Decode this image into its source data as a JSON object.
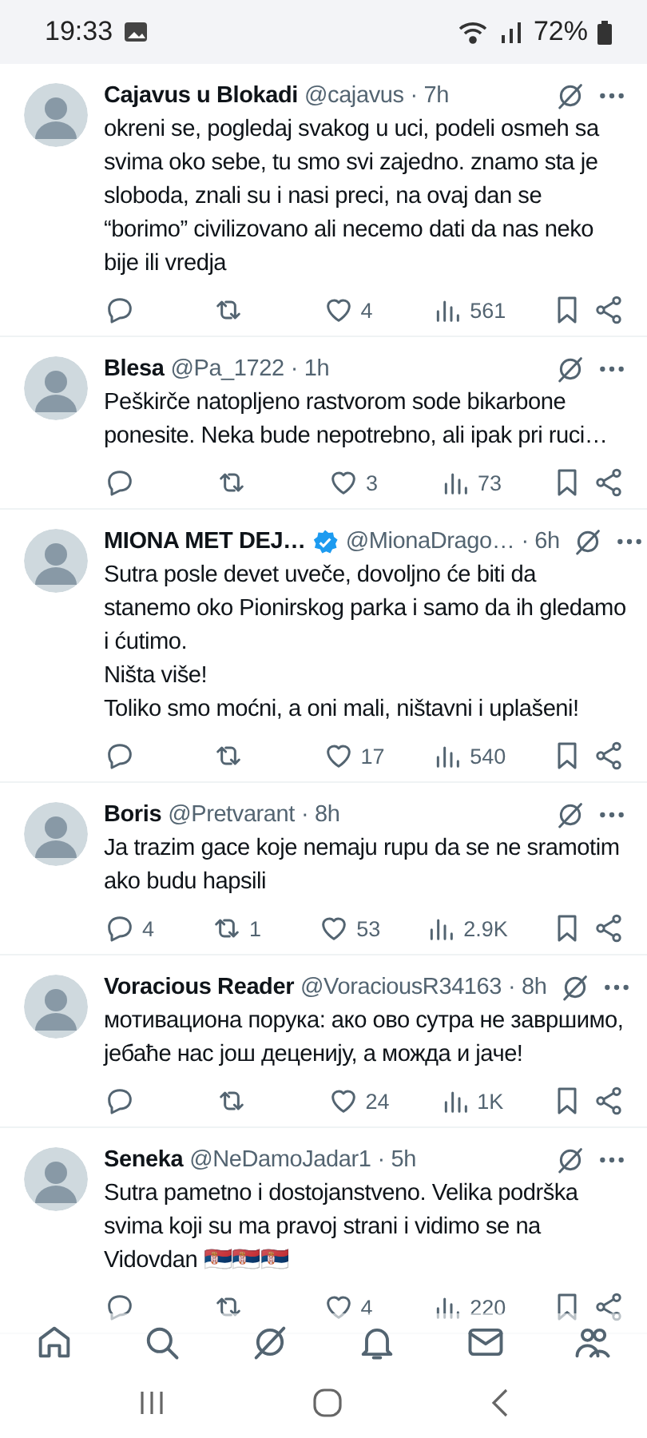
{
  "status_bar": {
    "time": "19:33",
    "battery": "72%"
  },
  "tweets": [
    {
      "name": "Cajavus u Blokadi",
      "verified": false,
      "handle": "@cajavus",
      "time": "· 7h",
      "text": "okreni se, pogledaj svakog u uci, podeli osmeh sa svima oko sebe, tu smo svi zajedno. znamo sta je sloboda, znali su i nasi preci, na ovaj dan se “borimo” civilizovano ali necemo dati da nas neko bije ili vredja",
      "likes": "4",
      "views": "561"
    },
    {
      "name": "Blesa",
      "verified": false,
      "handle": "@Pa_1722",
      "time": "· 1h",
      "text": "Peškirče natopljeno rastvorom sode bikarbone ponesite. Neka bude nepotrebno, ali ipak pri ruci…",
      "likes": "3",
      "views": "73"
    },
    {
      "name": "MIONA MET DEJ…",
      "verified": true,
      "handle": "@MionaDrago…",
      "time": "· 6h",
      "text": "Sutra posle devet uveče, dovoljno će biti da stanemo oko Pionirskog parka i samo da ih gledamo i ćutimo.\nNišta više!\nToliko smo moćni, a oni mali, ništavni i uplašeni!",
      "likes": "17",
      "views": "540"
    },
    {
      "name": "Boris",
      "verified": false,
      "handle": "@Pretvarant",
      "time": "· 8h",
      "text": "Ja trazim gace koje nemaju rupu da se ne sramotim ako budu hapsili",
      "replies": "4",
      "retweets": "1",
      "likes": "53",
      "views": "2.9K"
    },
    {
      "name": "Voracious Reader",
      "verified": false,
      "handle": "@VoraciousR34163",
      "time": "· 8h",
      "text": "мотивациона порука: ако ово сутра не завршимо, јебаће нас још деценију, а можда и јаче!",
      "likes": "24",
      "views": "1K"
    },
    {
      "name": "Seneka",
      "verified": false,
      "handle": "@NeDamoJadar1",
      "time": "· 5h",
      "text": "Sutra pametno i dostojanstveno. Velika podrška svima koji su ma pravoj strani i vidimo se na Vidovdan 🇷🇸🇷🇸🇷🇸",
      "likes": "4",
      "views": "220"
    }
  ]
}
